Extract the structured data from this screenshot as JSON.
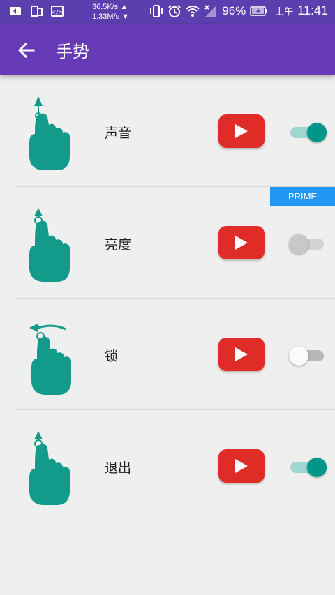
{
  "status_bar": {
    "speed_up": "36.5K/s ▲",
    "speed_down": "1.33M/s ▼",
    "battery_pct": "96%",
    "time_prefix": "上午",
    "time": "11:41"
  },
  "app_bar": {
    "title": "手势",
    "back_icon": "arrow-left-icon"
  },
  "badge": {
    "label": "PRIME"
  },
  "colors": {
    "status_bar": "#5b3fae",
    "app_bar": "#673ab7",
    "accent": "#009688",
    "hand": "#129b8a",
    "youtube_red": "#e02c26",
    "prime_blue": "#2196f3"
  },
  "gestures": [
    {
      "label": "声音",
      "gesture_icon": "swipe-up-hand-icon",
      "video_icon": "youtube-play-icon",
      "enabled": true
    },
    {
      "label": "亮度",
      "gesture_icon": "swipe-up-hand-icon",
      "video_icon": "youtube-play-icon",
      "enabled": false
    },
    {
      "label": "锁",
      "gesture_icon": "swipe-left-hand-icon",
      "video_icon": "youtube-play-icon",
      "enabled": false
    },
    {
      "label": "退出",
      "gesture_icon": "swipe-up-hand-icon",
      "video_icon": "youtube-play-icon",
      "enabled": true
    }
  ]
}
